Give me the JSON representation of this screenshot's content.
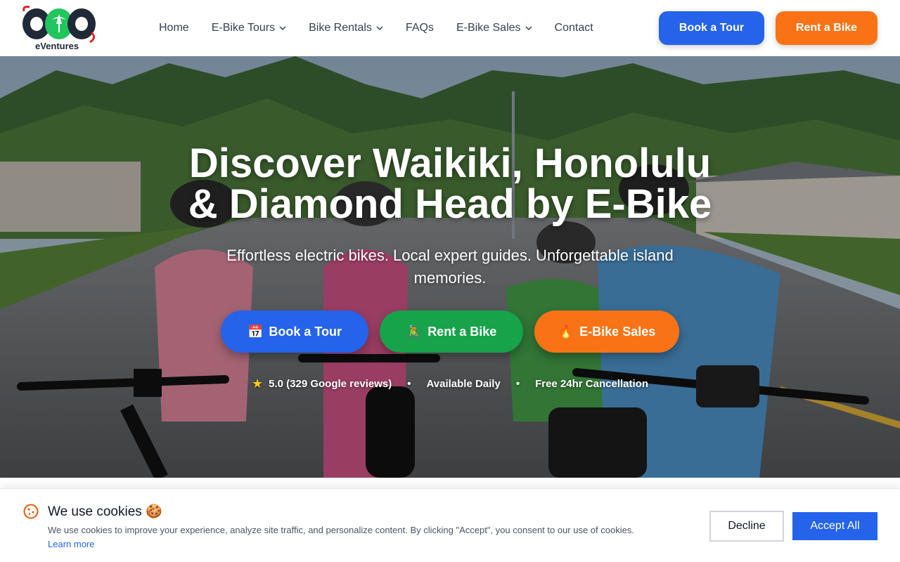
{
  "brand": {
    "logo_text": "808",
    "logo_subtext": "eVentures"
  },
  "nav": {
    "items": [
      {
        "label": "Home",
        "has_dropdown": false
      },
      {
        "label": "E-Bike Tours",
        "has_dropdown": true
      },
      {
        "label": "Bike Rentals",
        "has_dropdown": true
      },
      {
        "label": "FAQs",
        "has_dropdown": false
      },
      {
        "label": "E-Bike Sales",
        "has_dropdown": true
      },
      {
        "label": "Contact",
        "has_dropdown": false
      }
    ],
    "book_tour": "Book a Tour",
    "rent_bike": "Rent a Bike"
  },
  "hero": {
    "title_line1": "Discover Waikiki, Honolulu",
    "title_line2": "& Diamond Head by E-Bike",
    "subtitle": "Effortless electric bikes. Local expert guides. Unforgettable island memories.",
    "cta_tour": {
      "icon": "📅",
      "label": "Book a Tour"
    },
    "cta_rent": {
      "icon": "🚴",
      "label": "Rent a Bike"
    },
    "cta_sales": {
      "icon": "🔥",
      "label": "E-Bike Sales"
    },
    "rating": "5.0 (329 Google reviews)",
    "availability": "Available Daily",
    "cancellation": "Free 24hr Cancellation",
    "separator": "•"
  },
  "cookie": {
    "title": "We use cookies 🍪",
    "text": "We use cookies to improve your experience, analyze site traffic, and personalize content. By clicking \"Accept\", you consent to our use of cookies.",
    "learn_more": "Learn more",
    "decline": "Decline",
    "accept": "Accept All"
  },
  "colors": {
    "primary_blue": "#2563eb",
    "orange": "#f97316",
    "green": "#16a34a"
  }
}
